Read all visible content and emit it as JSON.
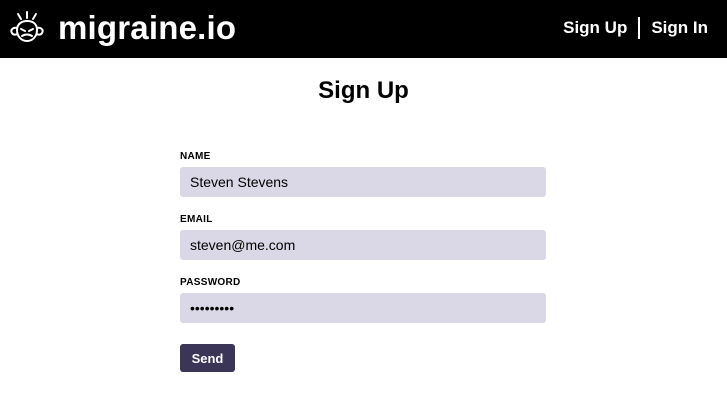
{
  "header": {
    "brand": "migraine.io",
    "logo_icon": "head-with-headache-icon",
    "nav": {
      "sign_up": "Sign Up",
      "sign_in": "Sign In"
    },
    "colors": {
      "background": "#000000",
      "text": "#ffffff"
    }
  },
  "main": {
    "title": "Sign Up",
    "form": {
      "name": {
        "label": "NAME",
        "value": "Steven Stevens"
      },
      "email": {
        "label": "EMAIL",
        "value": "steven@me.com"
      },
      "password": {
        "label": "PASSWORD",
        "value": "stevenpwd"
      },
      "submit_label": "Send"
    },
    "colors": {
      "input_bg": "#dad8e6",
      "button_bg": "#3b3558"
    }
  }
}
